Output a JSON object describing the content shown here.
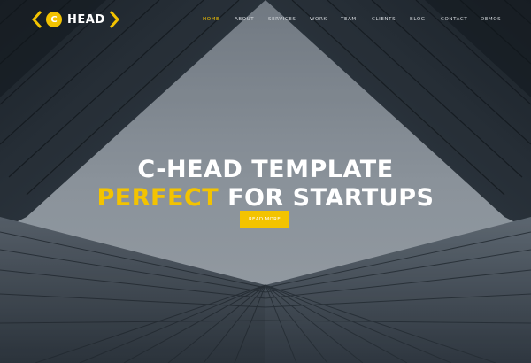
{
  "brand": {
    "badge_letter": "C",
    "name": "HEAD",
    "accent_color": "#f3c300"
  },
  "nav": {
    "items": [
      {
        "label": "HOME",
        "active": true
      },
      {
        "label": "ABOUT"
      },
      {
        "label": "SERVICES"
      },
      {
        "label": "WORK"
      },
      {
        "label": "TEAM"
      },
      {
        "label": "CLIENTS"
      },
      {
        "label": "BLOG"
      },
      {
        "label": "CONTACT"
      },
      {
        "label": "DEMOS"
      }
    ]
  },
  "hero": {
    "line1": "C-HEAD TEMPLATE",
    "line2_accent": "PERFECT",
    "line2_rest": " FOR STARTUPS",
    "cta_label": "READ MORE"
  }
}
